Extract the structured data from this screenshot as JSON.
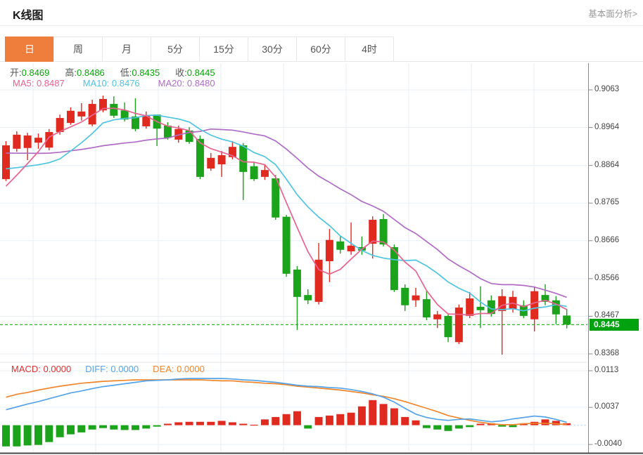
{
  "header": {
    "title": "K线图",
    "link_label": "基本面分析>"
  },
  "tabs": [
    {
      "label": "日",
      "active": true
    },
    {
      "label": "周",
      "active": false
    },
    {
      "label": "月",
      "active": false
    },
    {
      "label": "5分",
      "active": false
    },
    {
      "label": "15分",
      "active": false
    },
    {
      "label": "30分",
      "active": false
    },
    {
      "label": "60分",
      "active": false
    },
    {
      "label": "4时",
      "active": false
    }
  ],
  "overlay": {
    "ohlc_items": [
      {
        "label": "开:",
        "value": "0.8469"
      },
      {
        "label": "高:",
        "value": "0.8486"
      },
      {
        "label": "低:",
        "value": "0.8435"
      },
      {
        "label": "收:",
        "value": "0.8445"
      }
    ],
    "ma_items": [
      {
        "label": "MA5:",
        "value": "0.8487",
        "color": "#e8638f"
      },
      {
        "label": "MA10:",
        "value": "0.8476",
        "color": "#4ec4e0"
      },
      {
        "label": "MA20:",
        "value": "0.8480",
        "color": "#b06cc5"
      }
    ],
    "macd_items": [
      {
        "label": "MACD:",
        "value": "0.0000",
        "color": "#e03030"
      },
      {
        "label": "DIFF:",
        "value": "0.0000",
        "color": "#55a3e8"
      },
      {
        "label": "DEA:",
        "value": "0.0000",
        "color": "#f0862c"
      }
    ]
  },
  "y_axis": {
    "main_ticks": [
      {
        "label": "0.9063",
        "price": 0.9063
      },
      {
        "label": "0.8964",
        "price": 0.8964
      },
      {
        "label": "0.8864",
        "price": 0.8864
      },
      {
        "label": "0.8765",
        "price": 0.8765
      },
      {
        "label": "0.8666",
        "price": 0.8666
      },
      {
        "label": "0.8566",
        "price": 0.8566
      },
      {
        "label": "0.8467",
        "price": 0.8467
      },
      {
        "label": "0.8368",
        "price": 0.8368
      }
    ],
    "macd_ticks": [
      {
        "label": "0.0113",
        "value": 0.0113
      },
      {
        "label": "0.0037",
        "value": 0.0037
      },
      {
        "label": "-0.0040",
        "value": -0.004
      }
    ],
    "current": {
      "label": "0.8445",
      "price": 0.8445
    }
  },
  "chart_data": {
    "type": "candlestick",
    "title": "K线图 (daily K-line with MA5/MA10/MA20 and MACD)",
    "legend_position": "top-left overlay",
    "grid": true,
    "price_axis": {
      "max": 0.9063,
      "min": 0.8368
    },
    "macd_axis": {
      "max": 0.0113,
      "min": -0.004
    },
    "current_price": 0.8445,
    "colors": {
      "up": "#e12a1f",
      "down": "#1ba31b",
      "ma5": "#e8638f",
      "ma10": "#4ec4e0",
      "ma20": "#b06cc5",
      "diff": "#55a3e8",
      "dea": "#f0862c",
      "accent": "#ef7d3b",
      "tag": "#00a210",
      "dashed": "#2eb82e",
      "grid": "#e9eff6"
    },
    "candles_ohlc": [
      [
        0.8828,
        0.8928,
        0.8823,
        0.8917
      ],
      [
        0.8908,
        0.8954,
        0.89,
        0.8945
      ],
      [
        0.891,
        0.895,
        0.8878,
        0.8943
      ],
      [
        0.8924,
        0.8948,
        0.8908,
        0.8937
      ],
      [
        0.8911,
        0.896,
        0.8904,
        0.8952
      ],
      [
        0.8952,
        0.8998,
        0.8945,
        0.8989
      ],
      [
        0.8976,
        0.9017,
        0.8971,
        0.9008
      ],
      [
        0.8993,
        0.9028,
        0.8982,
        0.9006
      ],
      [
        0.8972,
        0.9037,
        0.8967,
        0.9026
      ],
      [
        0.9009,
        0.9048,
        0.9004,
        0.9039
      ],
      [
        0.9026,
        0.9046,
        0.8989,
        0.8995
      ],
      [
        0.9009,
        0.903,
        0.898,
        0.8985
      ],
      [
        0.8993,
        0.9041,
        0.8954,
        0.896
      ],
      [
        0.8967,
        0.9006,
        0.8961,
        0.8995
      ],
      [
        0.8998,
        0.8998,
        0.8915,
        0.8961
      ],
      [
        0.8969,
        0.8978,
        0.8932,
        0.8937
      ],
      [
        0.8932,
        0.8969,
        0.8924,
        0.896
      ],
      [
        0.8956,
        0.8965,
        0.8921,
        0.8926
      ],
      [
        0.8934,
        0.8943,
        0.8828,
        0.8834
      ],
      [
        0.8856,
        0.8897,
        0.885,
        0.8884
      ],
      [
        0.8867,
        0.8902,
        0.8834,
        0.8891
      ],
      [
        0.8886,
        0.8928,
        0.888,
        0.8913
      ],
      [
        0.8917,
        0.8923,
        0.8773,
        0.8847
      ],
      [
        0.8862,
        0.8873,
        0.8823,
        0.8828
      ],
      [
        0.8834,
        0.8867,
        0.8826,
        0.8852
      ],
      [
        0.883,
        0.8839,
        0.8721,
        0.8727
      ],
      [
        0.8729,
        0.8734,
        0.8571,
        0.8579
      ],
      [
        0.859,
        0.8599,
        0.8431,
        0.8518
      ],
      [
        0.8523,
        0.8538,
        0.8499,
        0.8509
      ],
      [
        0.8505,
        0.866,
        0.8498,
        0.8616
      ],
      [
        0.8612,
        0.8697,
        0.8557,
        0.8668
      ],
      [
        0.8664,
        0.8679,
        0.8632,
        0.8642
      ],
      [
        0.8638,
        0.8714,
        0.8629,
        0.8653
      ],
      [
        0.8649,
        0.8677,
        0.8629,
        0.864
      ],
      [
        0.8658,
        0.873,
        0.8619,
        0.8721
      ],
      [
        0.8723,
        0.8736,
        0.8651,
        0.8656
      ],
      [
        0.8649,
        0.8656,
        0.8531,
        0.8536
      ],
      [
        0.8542,
        0.8551,
        0.8481,
        0.8496
      ],
      [
        0.8509,
        0.8542,
        0.8492,
        0.8522
      ],
      [
        0.8512,
        0.8536,
        0.8457,
        0.8464
      ],
      [
        0.8459,
        0.8481,
        0.8436,
        0.8472
      ],
      [
        0.8468,
        0.8475,
        0.8399,
        0.8412
      ],
      [
        0.8399,
        0.8498,
        0.8394,
        0.849
      ],
      [
        0.8468,
        0.8531,
        0.8462,
        0.8514
      ],
      [
        0.8492,
        0.8546,
        0.8436,
        0.8483
      ],
      [
        0.8509,
        0.8522,
        0.8466,
        0.8473
      ],
      [
        0.8481,
        0.8538,
        0.8366,
        0.852
      ],
      [
        0.8486,
        0.8534,
        0.8477,
        0.8518
      ],
      [
        0.8496,
        0.8509,
        0.8462,
        0.8468
      ],
      [
        0.8459,
        0.8546,
        0.8427,
        0.8533
      ],
      [
        0.8523,
        0.8551,
        0.8496,
        0.8505
      ],
      [
        0.8509,
        0.852,
        0.8446,
        0.8472
      ],
      [
        0.8469,
        0.8486,
        0.8435,
        0.8445
      ]
    ],
    "ma_seed_closes": [
      0.895,
      0.8945,
      0.8945,
      0.894,
      0.894,
      0.8935,
      0.8935,
      0.8935,
      0.893,
      0.8925,
      0.8915,
      0.8905,
      0.89,
      0.8895,
      0.889,
      0.88,
      0.879,
      0.878,
      0.876
    ],
    "macd_hist": [
      -0.0044,
      -0.0044,
      -0.0042,
      -0.0041,
      -0.0035,
      -0.0025,
      -0.0019,
      -0.0015,
      -0.0009,
      -0.0006,
      -0.0009,
      -0.001,
      -0.001,
      -0.0007,
      -0.0003,
      0.0003,
      0.0006,
      0.0007,
      0.0007,
      0.0007,
      0.0009,
      0.0006,
      0.0003,
      0.0001,
      0.0012,
      0.0017,
      0.0023,
      0.0029,
      -0.0007,
      0.0017,
      0.002,
      0.0023,
      0.0026,
      0.0039,
      0.0052,
      0.0044,
      0.0035,
      0.0017,
      0.001,
      -0.0006,
      -0.0009,
      -0.0012,
      -0.0007,
      -0.0004,
      0.0003,
      0.0004,
      -0.0003,
      -0.0004,
      0.0004,
      0.0007,
      0.0012,
      0.0009,
      0.0004
    ],
    "diff_line": [
      0.0032,
      0.0038,
      0.0044,
      0.0049,
      0.0055,
      0.0061,
      0.0067,
      0.0071,
      0.0076,
      0.008,
      0.0083,
      0.0086,
      0.0089,
      0.0092,
      0.0093,
      0.0094,
      0.0096,
      0.0097,
      0.0097,
      0.0097,
      0.0097,
      0.0096,
      0.0094,
      0.0093,
      0.0091,
      0.0089,
      0.0086,
      0.0083,
      0.0081,
      0.008,
      0.0078,
      0.0077,
      0.0074,
      0.007,
      0.0065,
      0.0058,
      0.0048,
      0.0035,
      0.0023,
      0.0016,
      0.0012,
      0.001,
      0.0012,
      0.0013,
      0.001,
      0.0007,
      0.0009,
      0.0013,
      0.0016,
      0.0019,
      0.0017,
      0.0012,
      0.0006
    ],
    "dea_line": [
      0.0058,
      0.0064,
      0.0068,
      0.0073,
      0.0077,
      0.0081,
      0.0084,
      0.0087,
      0.0089,
      0.0091,
      0.0092,
      0.0093,
      0.0094,
      0.0094,
      0.0094,
      0.0094,
      0.0094,
      0.0094,
      0.0094,
      0.0093,
      0.0092,
      0.0092,
      0.009,
      0.0089,
      0.0087,
      0.0086,
      0.0084,
      0.0081,
      0.0079,
      0.0077,
      0.0075,
      0.0073,
      0.007,
      0.0067,
      0.0063,
      0.006,
      0.0055,
      0.0049,
      0.0042,
      0.0035,
      0.0028,
      0.002,
      0.0015,
      0.001,
      0.0006,
      0.0003,
      0.0001,
      0.0001,
      0.0003,
      0.0004,
      0.0004,
      0.0003,
      0.0001
    ]
  }
}
